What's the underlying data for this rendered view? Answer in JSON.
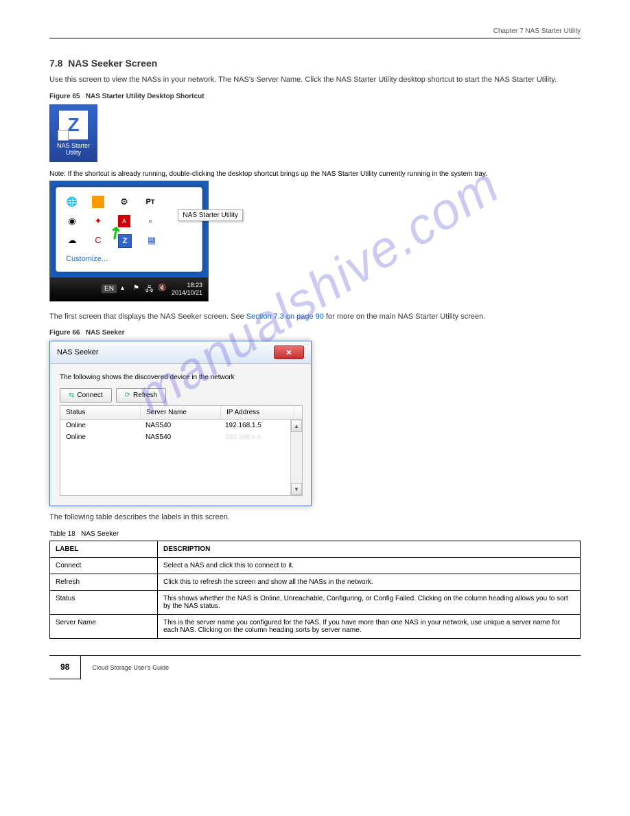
{
  "header": {
    "chapter": "Chapter 7 NAS Starter Utility"
  },
  "section": {
    "number": "7.8",
    "title": "NAS Seeker Screen"
  },
  "intro_text": "Use this screen to view the NASs in your network. The NAS's Server Name. Click the NAS Starter Utility desktop shortcut to start the NAS Starter Utility.",
  "figure1": {
    "label": "Figure 65",
    "title": "NAS Starter Utility Desktop Shortcut"
  },
  "icon_label": "NAS Starter Utility",
  "note_text": "Note: If the shortcut is already running, double-clicking the desktop shortcut brings up the NAS Starter Utility currently running in the system tray.",
  "tray": {
    "tooltip": "NAS Starter Utility",
    "customize": "Customize...",
    "lang": "EN",
    "time": "18:23",
    "date": "2014/10/21"
  },
  "figure2": {
    "label": "Figure 66",
    "title": "NAS Seeker"
  },
  "seeker": {
    "window_title": "NAS Seeker",
    "desc": "The following shows the discovered device in the network",
    "connect_btn": "Connect",
    "refresh_btn": "Refresh",
    "columns": {
      "status": "Status",
      "name": "Server Name",
      "ip": "IP Address"
    },
    "rows": [
      {
        "status": "Online",
        "name": "NAS540",
        "ip": "192.168.1.5"
      },
      {
        "status": "Online",
        "name": "NAS540",
        "ip": ""
      }
    ]
  },
  "table_intro": "The following table describes the labels in this screen.",
  "table_caption": {
    "num": "Table 18",
    "title": "NAS Seeker"
  },
  "table": {
    "head": {
      "label": "LABEL",
      "desc": "DESCRIPTION"
    },
    "rows": [
      {
        "label": "Connect",
        "desc": "Select a NAS and click this to connect to it."
      },
      {
        "label": "Refresh",
        "desc": "Click this to refresh the screen and show all the NASs in the network."
      },
      {
        "label": "Status",
        "desc": "This shows whether the NAS is Online, Unreachable, Configuring, or Config Failed. Clicking on the column heading allows you to sort by the NAS status."
      },
      {
        "label": "Server Name",
        "desc": "This is the server name you configured for the NAS. If you have more than one NAS in your network, use unique a server name for each NAS. Clicking on the column heading sorts by server name."
      }
    ]
  },
  "footer": {
    "page": "98",
    "product": "Cloud Storage User's Guide"
  },
  "watermark": "manualshive.com"
}
